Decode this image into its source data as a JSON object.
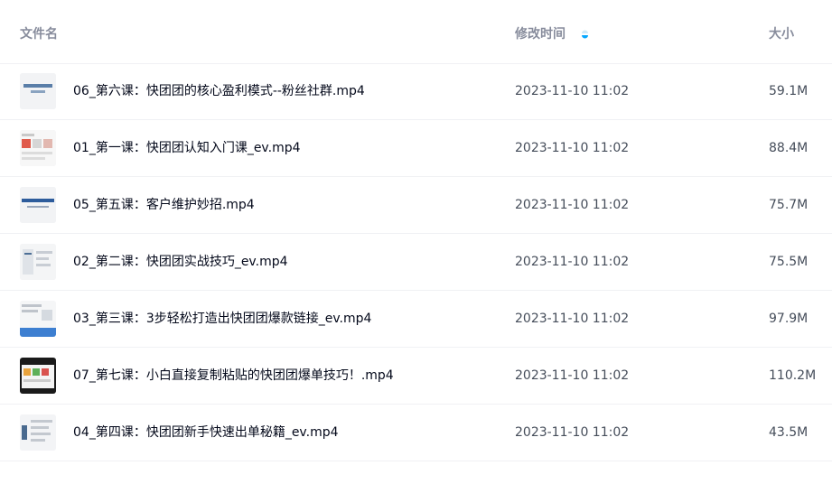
{
  "header": {
    "name_label": "文件名",
    "time_label": "修改时间",
    "size_label": "大小",
    "sort_icon": "sort-toggle-icon",
    "accent_color": "#06a7ff"
  },
  "files": [
    {
      "name": "06_第六课：快团团的核心盈利模式--粉丝社群.mp4",
      "time": "2023-11-10 11:02",
      "size": "59.1M",
      "thumb_text": "「时尚搞搞」\n频道",
      "thumb_icon": "video-thumbnail-icon"
    },
    {
      "name": "01_第一课：快团团认知入门课_ev.mp4",
      "time": "2023-11-10 11:02",
      "size": "88.4M",
      "thumb_text": "",
      "thumb_icon": "video-thumbnail-icon"
    },
    {
      "name": "05_第五课：客户维护妙招.mp4",
      "time": "2023-11-10 11:02",
      "size": "75.7M",
      "thumb_text": "单新人礼直接变",
      "thumb_icon": "video-thumbnail-icon"
    },
    {
      "name": "02_第二课：快团团实战技巧_ev.mp4",
      "time": "2023-11-10 11:02",
      "size": "75.5M",
      "thumb_text": "",
      "thumb_icon": "video-thumbnail-icon"
    },
    {
      "name": "03_第三课：3步轻松打造出快团团爆款链接_ev.mp4",
      "time": "2023-11-10 11:02",
      "size": "97.9M",
      "thumb_text": "",
      "thumb_icon": "video-thumbnail-icon"
    },
    {
      "name": "07_第七课：小白直接复制粘贴的快团团爆单技巧！.mp4",
      "time": "2023-11-10 11:02",
      "size": "110.2M",
      "thumb_text": "",
      "thumb_icon": "video-thumbnail-icon"
    },
    {
      "name": "04_第四课：快团团新手快速出单秘籍_ev.mp4",
      "time": "2023-11-10 11:02",
      "size": "43.5M",
      "thumb_text": "",
      "thumb_icon": "video-thumbnail-icon"
    }
  ]
}
